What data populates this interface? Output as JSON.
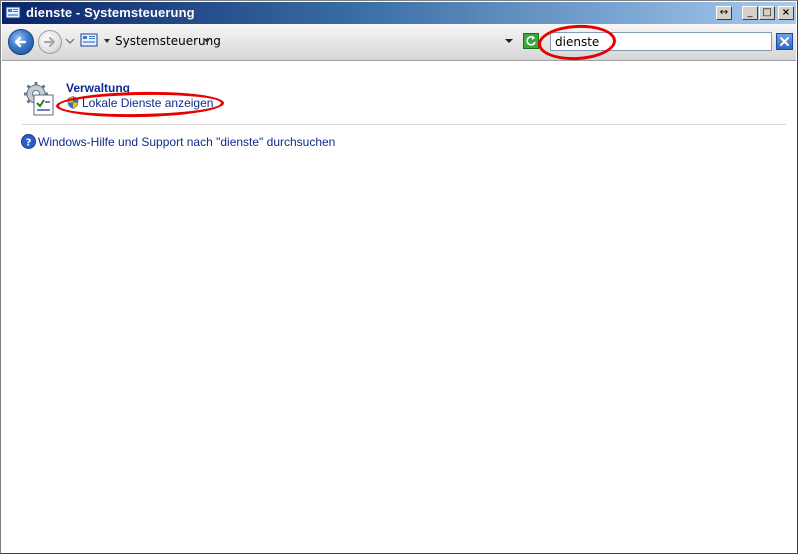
{
  "window": {
    "title": "dienste - Systemsteuerung",
    "buttons": {
      "restore": "↔",
      "minimize": "_",
      "maximize": "□",
      "close": "×"
    }
  },
  "navbar": {
    "back_icon": "back-arrow-icon",
    "forward_icon": "forward-arrow-icon",
    "breadcrumb": "Systemsteuerung",
    "search_value": "dienste",
    "search_clear_icon": "close-icon"
  },
  "content": {
    "group": {
      "title": "Verwaltung",
      "icon": "administrative-tools-icon",
      "task": {
        "label": "Lokale Dienste anzeigen",
        "icon": "uac-shield-icon"
      }
    },
    "help_link": {
      "label": "Windows-Hilfe und Support nach \"dienste\" durchsuchen",
      "icon": "help-icon"
    }
  },
  "colors": {
    "titlebar_start": "#0a246a",
    "titlebar_end": "#a6caf0",
    "link": "#0f2b8c",
    "group_title": "#15428b",
    "annotation": "#e60000"
  }
}
